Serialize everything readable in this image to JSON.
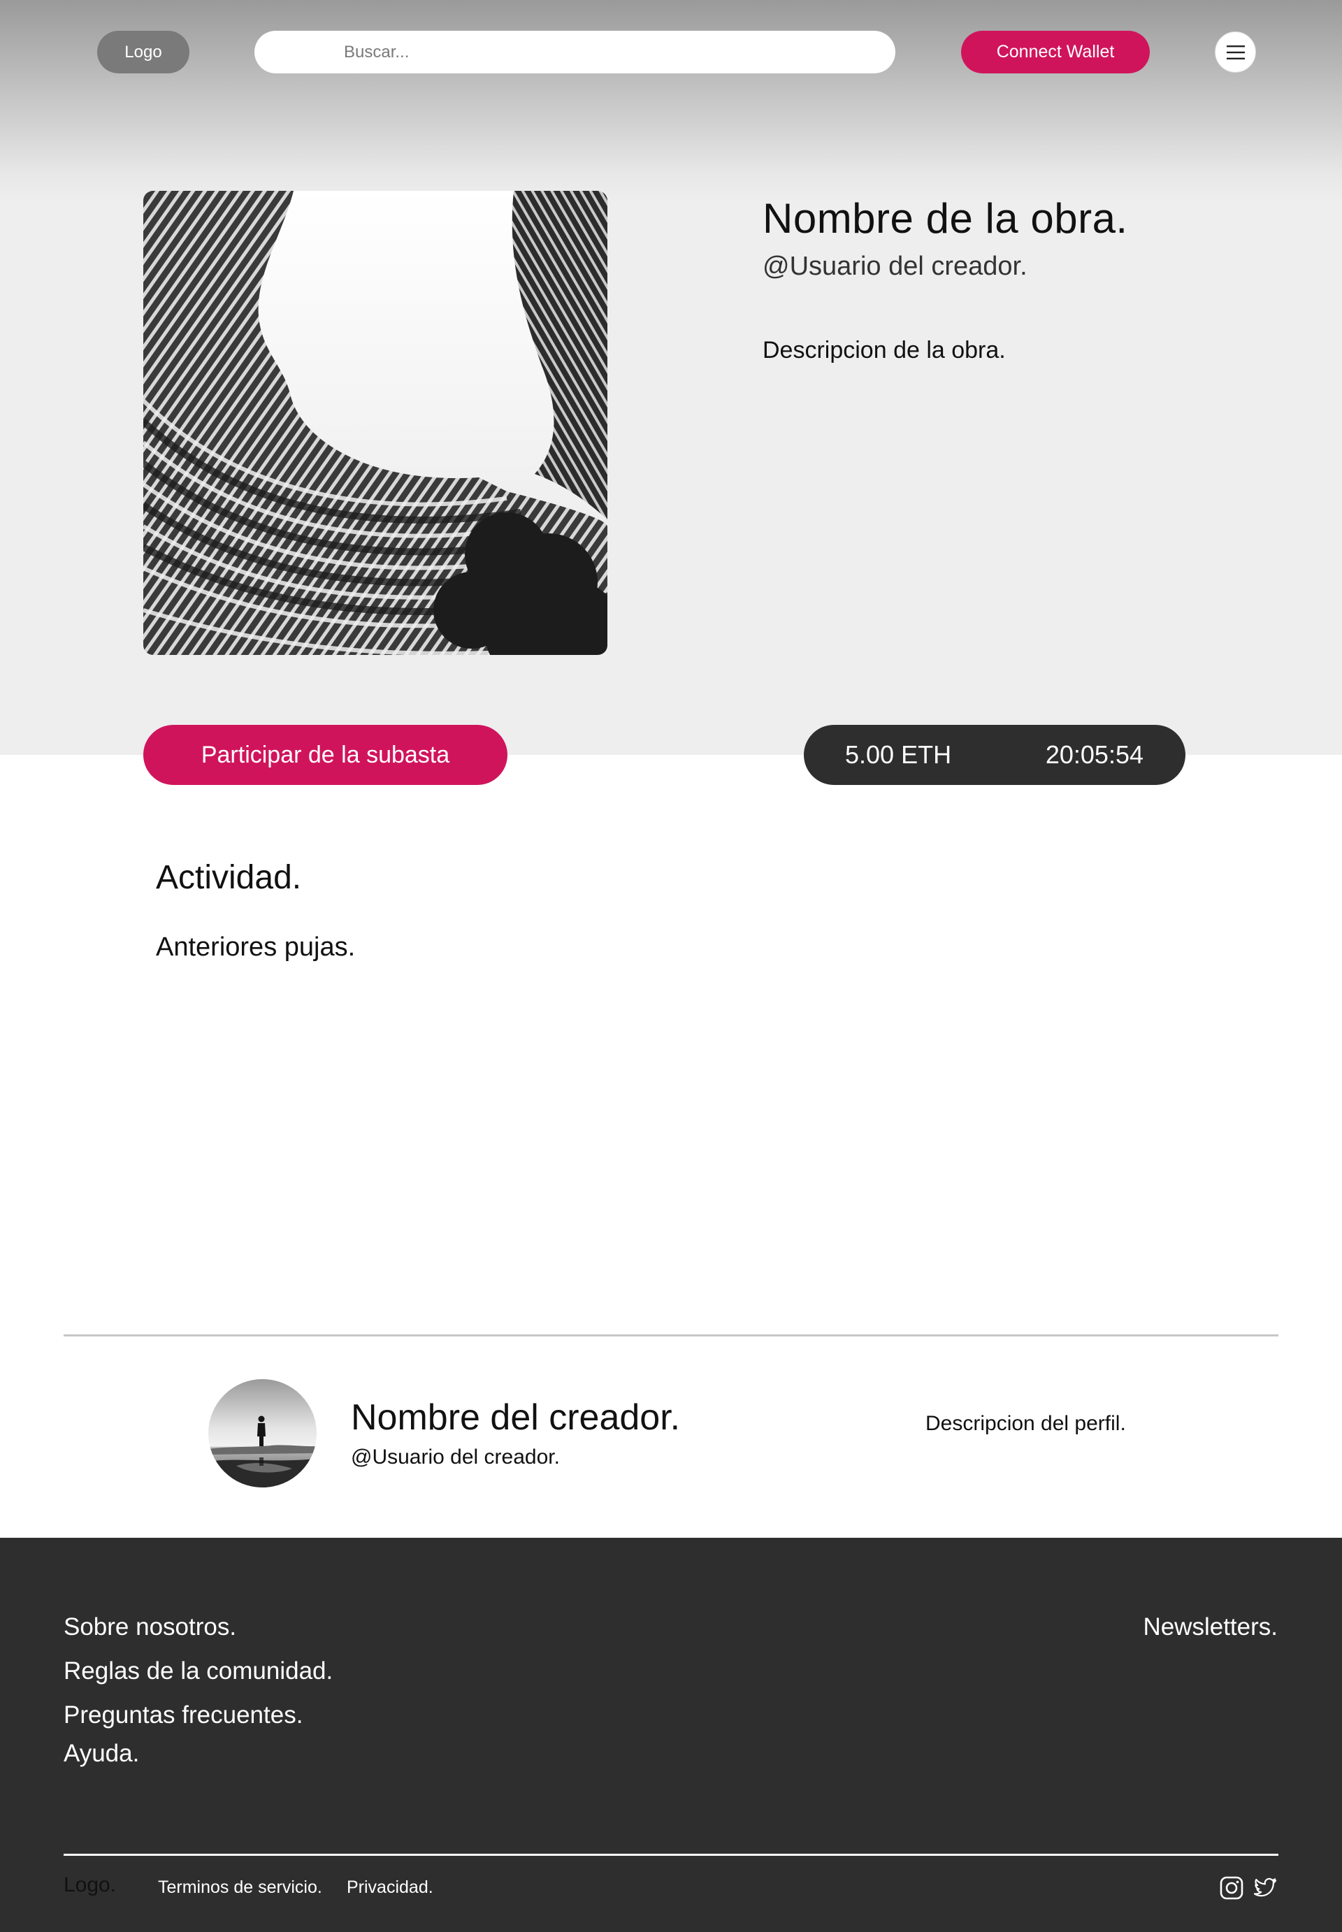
{
  "header": {
    "logo_label": "Logo",
    "search_placeholder": "Buscar...",
    "connect_wallet_label": "Connect Wallet",
    "menu_icon": "hamburger-menu-icon"
  },
  "artwork": {
    "image_icon": "curved-building-photo",
    "title": "Nombre de la obra.",
    "creator_user": "@Usuario del creador.",
    "description": "Descripcion de la obra."
  },
  "auction": {
    "bid_button_label": "Participar de la subasta",
    "price": "5.00 ETH",
    "time_left": "20:05:54"
  },
  "activity": {
    "title": "Actividad.",
    "subtitle": "Anteriores pujas."
  },
  "creator": {
    "avatar_icon": "person-silhouette-photo",
    "name": "Nombre del creador.",
    "user": "@Usuario del creador.",
    "description": "Descripcion del perfil."
  },
  "footer": {
    "links": [
      "Sobre nosotros.",
      "Reglas de la comunidad.",
      "Preguntas frecuentes.",
      "Ayuda."
    ],
    "newsletters": "Newsletters.",
    "logo": "Logo.",
    "terms": "Terminos de servicio.",
    "privacy": "Privacidad.",
    "social_icons": [
      "instagram-icon",
      "twitter-icon"
    ]
  },
  "colors": {
    "accent": "#d0145c",
    "dark": "#2e2e2e",
    "hero_bg": "#eeeeee"
  }
}
